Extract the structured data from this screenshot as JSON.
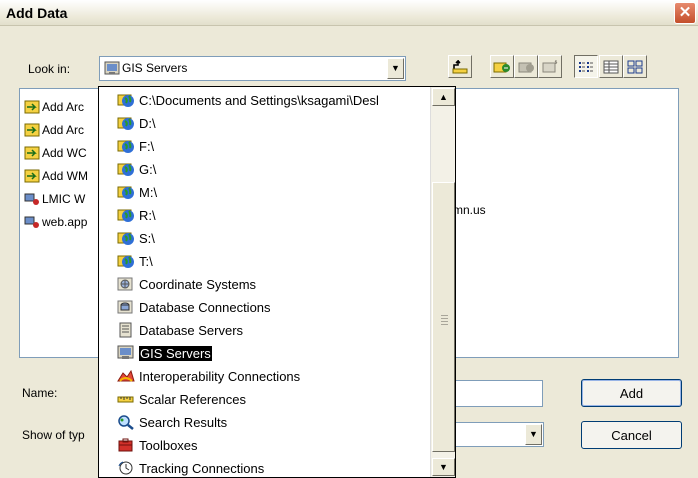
{
  "window": {
    "title": "Add Data"
  },
  "look_in": {
    "label": "Look in:",
    "value": "GIS Servers"
  },
  "toolbar": {
    "up_icon": "up-folder-icon",
    "connect_icon": "connect-to-folder-icon",
    "disconnect_icon": "disconnect-folder-icon",
    "new_icon": "new-item-icon",
    "list_view_icon": "list-view-icon",
    "details_view_icon": "details-view-icon",
    "thumbnail_view_icon": "thumbnail-view-icon"
  },
  "file_list": {
    "items": [
      {
        "label": "Add Arc",
        "icon": "add-server-icon"
      },
      {
        "label": "Add Arc",
        "icon": "add-server-icon"
      },
      {
        "label": "Add WC",
        "icon": "add-server-icon"
      },
      {
        "label": "Add WM",
        "icon": "add-server-icon"
      },
      {
        "label": "LMIC W",
        "icon": "server-connection-icon"
      },
      {
        "label": "web.app",
        "icon": "server-connection-icon"
      }
    ],
    "obscured_tail": "mn.us"
  },
  "name": {
    "label": "Name:",
    "value": ""
  },
  "show_type": {
    "label": "Show of typ",
    "value": ""
  },
  "buttons": {
    "add": "Add",
    "cancel": "Cancel"
  },
  "dropdown": {
    "items": [
      {
        "label": "C:\\Documents and Settings\\ksagami\\Desl",
        "icon": "globe-folder-icon"
      },
      {
        "label": "D:\\",
        "icon": "globe-folder-icon"
      },
      {
        "label": "F:\\",
        "icon": "globe-folder-icon"
      },
      {
        "label": "G:\\",
        "icon": "globe-folder-icon"
      },
      {
        "label": "M:\\",
        "icon": "globe-folder-icon"
      },
      {
        "label": "R:\\",
        "icon": "globe-folder-icon"
      },
      {
        "label": "S:\\",
        "icon": "globe-folder-icon"
      },
      {
        "label": "T:\\",
        "icon": "globe-folder-icon"
      },
      {
        "label": "Coordinate Systems",
        "icon": "coordinate-systems-icon"
      },
      {
        "label": "Database Connections",
        "icon": "database-connections-icon"
      },
      {
        "label": "Database Servers",
        "icon": "database-servers-icon"
      },
      {
        "label": "GIS Servers",
        "icon": "gis-servers-icon",
        "selected": true
      },
      {
        "label": "Interoperability Connections",
        "icon": "interoperability-icon"
      },
      {
        "label": "Scalar References",
        "icon": "scalar-references-icon"
      },
      {
        "label": "Search Results",
        "icon": "search-results-icon"
      },
      {
        "label": "Toolboxes",
        "icon": "toolboxes-icon"
      },
      {
        "label": "Tracking Connections",
        "icon": "tracking-connections-icon"
      }
    ]
  }
}
